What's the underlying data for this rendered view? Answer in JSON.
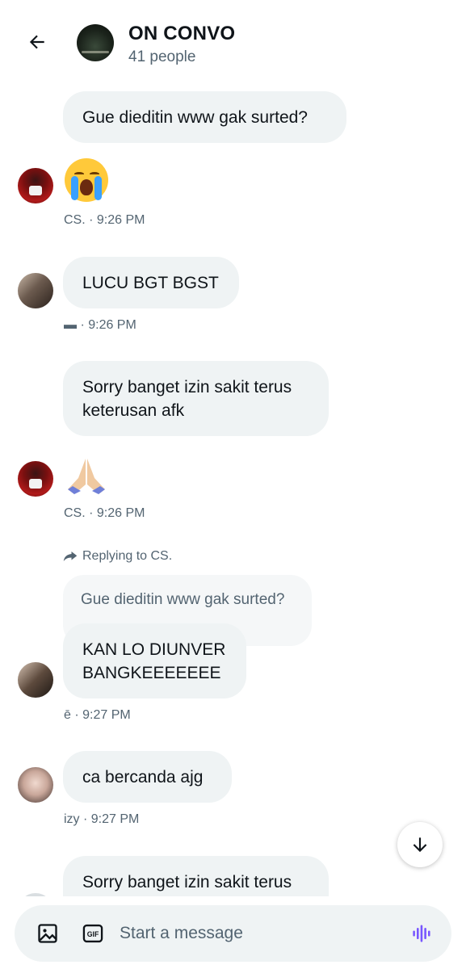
{
  "header": {
    "title": "ON CONVO",
    "subtitle": "41 people"
  },
  "messages": [
    {
      "text": "Gue dieditin www gak surted?"
    },
    {
      "emoji": "crying-face",
      "meta": "CS. · 9:26 PM"
    },
    {
      "text": "LUCU BGT BGST",
      "meta": "▬ · 9:26 PM"
    },
    {
      "text_lines": [
        "Sorry banget izin sakit terus",
        "keterusan afk"
      ]
    },
    {
      "emoji": "folded-hands",
      "meta": "CS. · 9:26 PM"
    },
    {
      "reply_label": "Replying to CS.",
      "quoted": "Gue dieditin www gak surted?",
      "text_lines": [
        "KAN LO DIUNVER",
        "BANGKEEEEEEE"
      ],
      "meta": "ē · 9:27 PM"
    },
    {
      "text": "ca bercanda ajg",
      "meta": "izy · 9:27 PM"
    },
    {
      "text": "Sorry banget izin sakit terus"
    }
  ],
  "composer": {
    "placeholder": "Start a message",
    "gif_label": "GIF"
  },
  "colors": {
    "bubble": "#eff3f4",
    "meta": "#536471",
    "voice_accent": "#7856ff"
  }
}
